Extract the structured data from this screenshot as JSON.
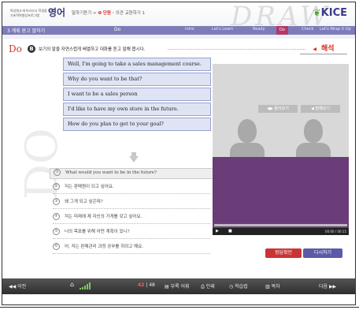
{
  "header": {
    "subtitle": "특성화고·마이스터고 학생을 위한 기초학력향상프로그램",
    "title": "영어",
    "crumb_prefix": "말하기듣기 >",
    "crumb_num": "❶",
    "crumb_unit": "단원 ·",
    "crumb_rest": "의견 교환하기 1",
    "watermark": "DRAW",
    "logo": "KICE",
    "logo_icon": "leaf-icon"
  },
  "navbar": {
    "step": "3   계획 묻고 말하기",
    "section": "Do",
    "tabs": [
      "Intro",
      "Let's Learn",
      "Ready",
      "Do",
      "Check",
      "Let's Wrap it Up"
    ],
    "active_tab": "Do"
  },
  "main": {
    "do_label": "Do",
    "watermark": "DO",
    "instruction_badge": "B",
    "instruction": "보기의 말을 자연스럽게 배열하고 대화를 듣고 말해 봅시다.",
    "answer_button": "해석",
    "sentences": [
      "Well, I'm going to take a sales management course.",
      "Why do you want to be that?",
      "I want to be a sales person",
      "I'd like to have my own store in the future.",
      "How do you plan to get to your goal?"
    ],
    "answers": [
      {
        "num": "①",
        "text": "What would you want to be in the future?"
      },
      {
        "num": "②",
        "text": "저는 판매원이 되고 싶어요."
      },
      {
        "num": "③",
        "text": "왜 그게 되고 싶은데?"
      },
      {
        "num": "④",
        "text": "저는 미래에 제 자신의 가게를 갖고 싶어요."
      },
      {
        "num": "⑤",
        "text": "너의 목표를 위해 어떤 계획이 있니?"
      },
      {
        "num": "⑥",
        "text": "어, 저는 판매관리 과정 공부를 하려고 해요."
      }
    ]
  },
  "video": {
    "listen_button": "◀▶ 들어보기",
    "speak_button": "◀ 말해보기",
    "time": "00:00 / 00:15",
    "play_icon": "play-icon",
    "stop_icon": "stop-icon"
  },
  "actions": {
    "check": "정답확인",
    "retry": "다시하기"
  },
  "footer": {
    "prev": "◀◀ 이전",
    "home_icon": "home-icon",
    "page_current": "42",
    "page_sep": "|",
    "page_total": "48",
    "menu1": "▤ 부록 어휘",
    "menu2": "⎙ 인쇄",
    "menu3": "◷ 학습법",
    "menu4": "▥ 목차",
    "next": "다음 ▶▶"
  }
}
